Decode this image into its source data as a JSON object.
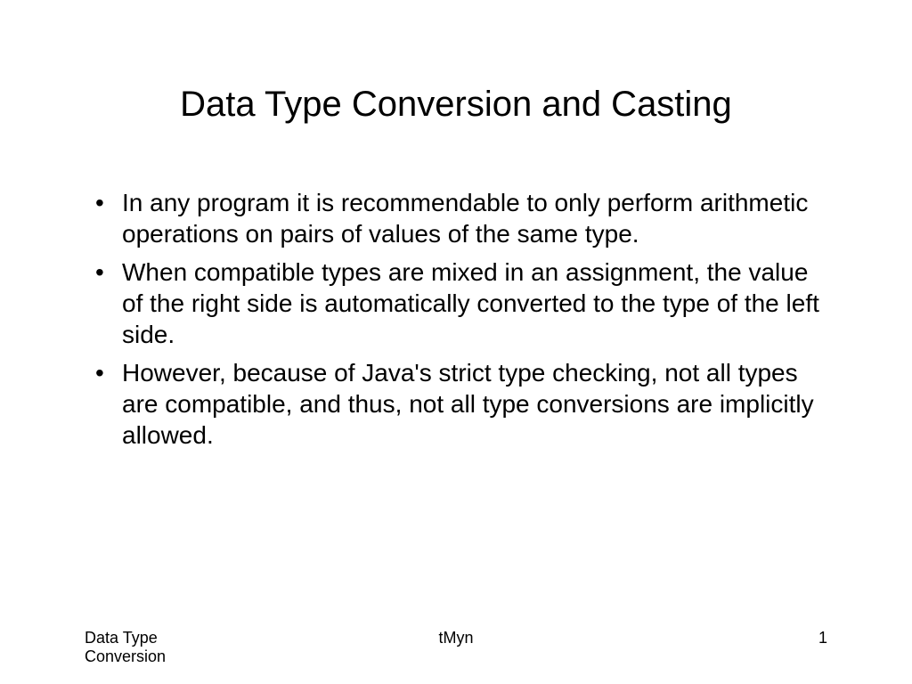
{
  "title": "Data Type Conversion and Casting",
  "bullets": [
    "In any program it is recommendable to only perform arithmetic operations on pairs of values of the same type.",
    "When compatible types are mixed in an assignment, the value of the right side is automatically converted to the type of the left side.",
    "However, because of Java's strict type checking, not all types are compatible, and thus, not all type conversions are implicitly allowed."
  ],
  "footer": {
    "left": "Data Type Conversion",
    "center": "tMyn",
    "right": "1"
  }
}
